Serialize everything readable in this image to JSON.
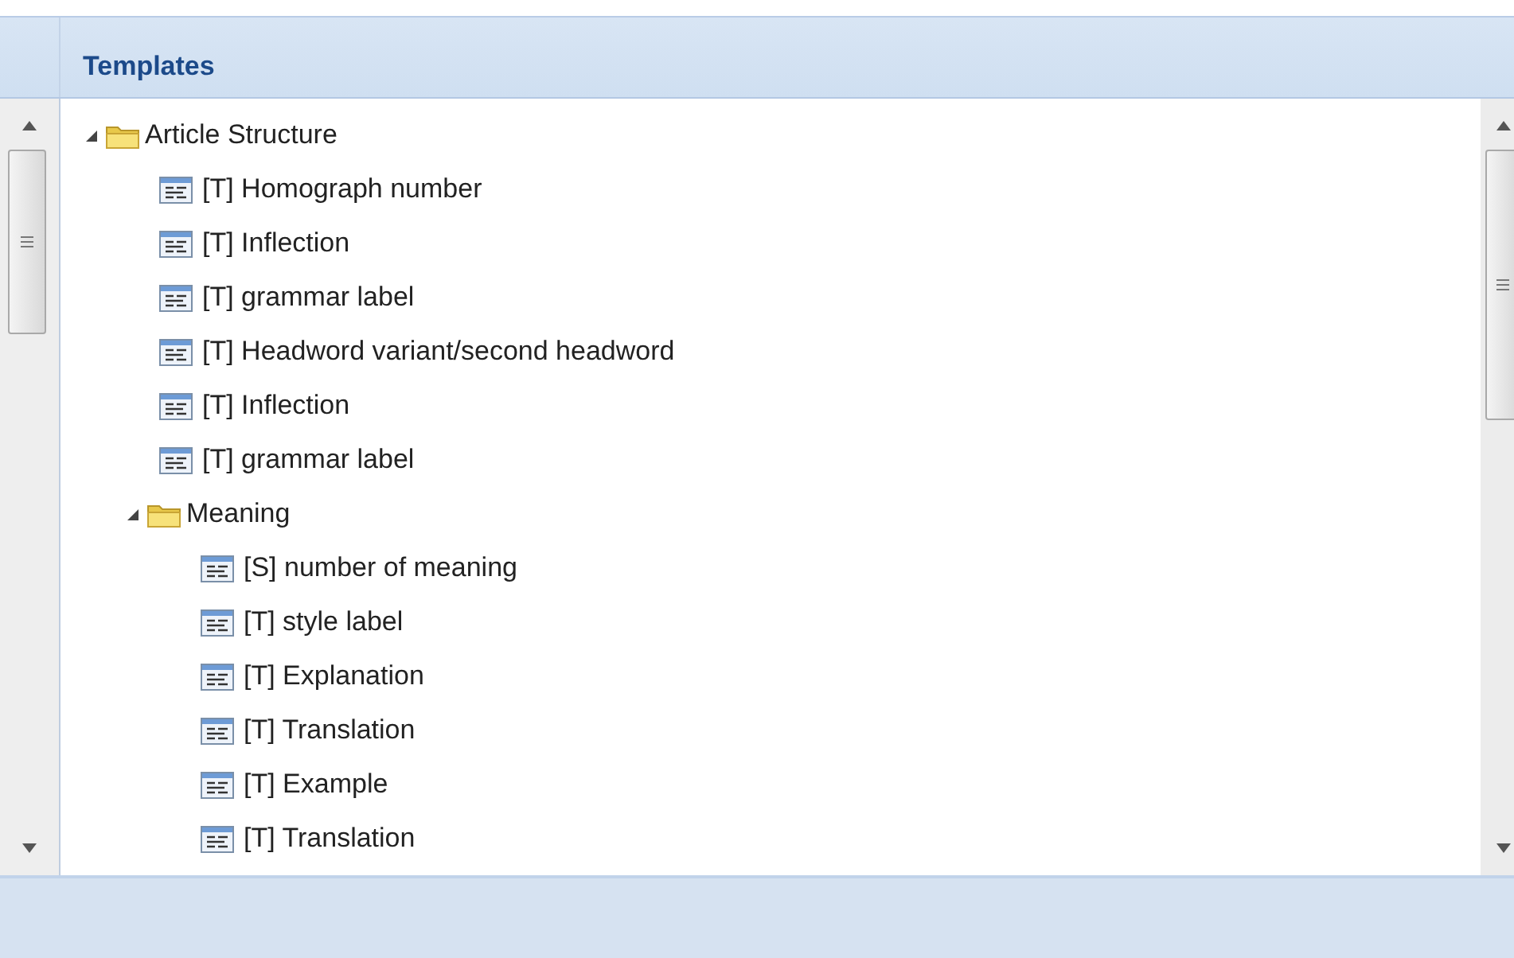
{
  "panel": {
    "title": "Templates"
  },
  "tree": [
    {
      "kind": "folder",
      "label": "Article Structure",
      "expanded": true,
      "children": [
        {
          "kind": "field",
          "label": "[T] Homograph number"
        },
        {
          "kind": "field",
          "label": "[T] Inflection"
        },
        {
          "kind": "field",
          "label": "[T] grammar label"
        },
        {
          "kind": "field",
          "label": "[T] Headword variant/second headword"
        },
        {
          "kind": "field",
          "label": "[T] Inflection"
        },
        {
          "kind": "field",
          "label": "[T] grammar label"
        },
        {
          "kind": "folder",
          "label": "Meaning",
          "expanded": true,
          "children": [
            {
              "kind": "field",
              "label": "[S] number of meaning"
            },
            {
              "kind": "field",
              "label": "[T] style label"
            },
            {
              "kind": "field",
              "label": "[T] Explanation"
            },
            {
              "kind": "field",
              "label": "[T] Translation"
            },
            {
              "kind": "field",
              "label": "[T] Example"
            },
            {
              "kind": "field",
              "label": "[T] Translation"
            }
          ]
        }
      ]
    }
  ]
}
